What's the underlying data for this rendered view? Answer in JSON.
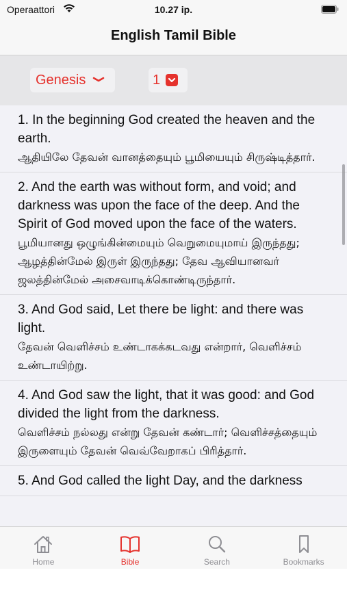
{
  "status": {
    "carrier": "Operaattori",
    "time": "10.27 ip."
  },
  "nav": {
    "title": "English Tamil Bible"
  },
  "picker": {
    "book": "Genesis",
    "chapter": "1"
  },
  "verses": [
    {
      "en": "1. In the beginning God created the heaven and the earth.",
      "ta": "ஆதியிலே தேவன் வானத்தையும் பூமியையும் சிருஷ்டித்தார்."
    },
    {
      "en": "2. And the earth was without form, and void; and darkness was upon the face of the deep. And the Spirit of God moved upon the face of the waters.",
      "ta": "பூமியானது ஒழுங்கின்மையும் வெறுமையுமாய் இருந்தது; ஆழத்தின்மேல் இருள் இருந்தது; தேவ ஆவியானவர் ஜலத்தின்மேல் அசைவாடிக்கொண்டிருந்தார்."
    },
    {
      "en": "3. And God said, Let there be light: and there was light.",
      "ta": "தேவன் வெளிச்சம் உண்டாகக்கடவது என்றார், வெளிச்சம் உண்டாயிற்று."
    },
    {
      "en": "4. And God saw the light, that it was good: and God divided the light from the darkness.",
      "ta": "வெளிச்சம் நல்லது என்று தேவன் கண்டார்; வெளிச்சத்தையும் இருளையும் தேவன் வெவ்வேறாகப் பிரித்தார்."
    },
    {
      "en": "5. And God called the light Day, and the darkness",
      "ta": ""
    }
  ],
  "tabs": [
    {
      "label": "Home",
      "icon": "home-icon"
    },
    {
      "label": "Bible",
      "icon": "book-icon",
      "active": true
    },
    {
      "label": "Search",
      "icon": "search-icon"
    },
    {
      "label": "Bookmarks",
      "icon": "bookmark-icon"
    }
  ],
  "colors": {
    "accent": "#e5322d",
    "inactive": "#8e8e93"
  }
}
